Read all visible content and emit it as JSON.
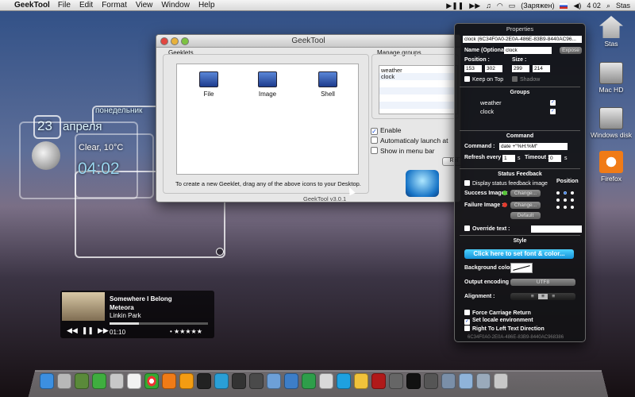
{
  "menubar": {
    "app_name": "GeekTool",
    "menus": [
      "File",
      "Edit",
      "Format",
      "View",
      "Window",
      "Help"
    ],
    "battery_status": "(Заряжен)",
    "clock": "4 02",
    "user": "Stas"
  },
  "desktop_icons": [
    {
      "label": "Stas",
      "icon": "home-folder-icon"
    },
    {
      "label": "Mac HD",
      "icon": "hard-disk-icon"
    },
    {
      "label": "Windows disk",
      "icon": "hard-disk-icon"
    },
    {
      "label": "Firefox",
      "icon": "firefox-icon"
    }
  ],
  "geeklets_desktop": {
    "weekday": "понедельник",
    "day": "23",
    "month": "апреля",
    "weather": "Clear, 10°C",
    "time": "04:02"
  },
  "geektool_window": {
    "title": "GeekTool",
    "geeklets_heading": "Geeklets",
    "geeklet_types": [
      {
        "label": "File",
        "icon": "file-geeklet-icon"
      },
      {
        "label": "Image",
        "icon": "image-geeklet-icon"
      },
      {
        "label": "Shell",
        "icon": "shell-geeklet-icon"
      }
    ],
    "hint": "To create a new Geeklet, drag any of the above icons to your Desktop.",
    "version": "GeekTool v3.0.1",
    "groups_heading": "Manage groups",
    "groups": [
      "weather",
      "clock"
    ],
    "enable_label": "Enable",
    "enable_checked": true,
    "autolaunch_label": "Automaticaly launch at",
    "autolaunch_checked": false,
    "menubar_label": "Show in menu bar",
    "menubar_checked": false,
    "refresh_label": "Ref"
  },
  "properties": {
    "title": "Properties",
    "geeklet_id": "clock (6C34F0A0-2E0A-486E-83B9-8440AC96...",
    "name_label": "Name (Optional) :",
    "name_value": "clock",
    "expose_label": "Expose",
    "position_label": "Position :",
    "size_label": "Size :",
    "pos_x": "153",
    "pos_y": "302",
    "width": "299",
    "height": "214",
    "keep_on_top": "Keep on Top",
    "shadow": "Shadow",
    "groups_heading": "Groups",
    "groups": [
      "weather",
      "clock"
    ],
    "command_heading": "Command",
    "command_label": "Command :",
    "command_value": "date +\"%H:%M\"",
    "refresh_label": "Refresh every",
    "refresh_value": "1",
    "refresh_unit": "s",
    "timeout_label": "Timeout :",
    "timeout_value": "0",
    "timeout_unit": "s",
    "status_heading": "Status Feedback",
    "display_status": "Display status feedback image",
    "position_heading": "Position",
    "success_label": "Success Image :",
    "failure_label": "Failure Image :",
    "change_label": "Change...",
    "default_label": "Default",
    "override_label": "Override text :",
    "style_heading": "Style",
    "font_button": "Click here to set font & color...",
    "bg_color_label": "Background color :",
    "encoding_label": "Output encoding :",
    "encoding_value": "UTF8",
    "alignment_label": "Alignment :",
    "force_cr": "Force Carriage Return",
    "set_locale": "Set locale environment",
    "rtl": "Right To Left Text Direction",
    "footer_id": "6C34F0A0-2E0A-486E-83B9-8440AC968386"
  },
  "music": {
    "title": "Somewhere I Belong",
    "album": "Meteora",
    "artist": "Linkin Park",
    "elapsed": "01:10",
    "rating": "• ★★★★★",
    "progress_fraction": 0.3
  }
}
